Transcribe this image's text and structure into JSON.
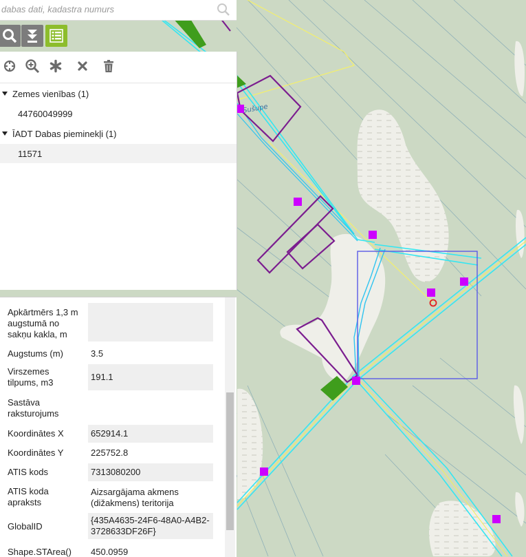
{
  "search": {
    "placeholder": "dabas dati, kadastra numurs"
  },
  "toolbar": {
    "search_icon": "search-icon",
    "download_icon": "download-icon",
    "list_icon": "list-icon"
  },
  "actions": [
    "crosshair-icon",
    "zoom-in-icon",
    "asterisk-icon",
    "close-icon",
    "trash-icon"
  ],
  "results": {
    "groups": [
      {
        "label": "Zemes vienības (1)",
        "items": [
          "44760049999"
        ]
      },
      {
        "label": "ĪADT Dabas pieminekļi (1)",
        "items": [
          "11571"
        ]
      }
    ]
  },
  "details": [
    {
      "key": "Apkārtmērs 1,3 m augstumā no sakņu kakla, m",
      "value": ""
    },
    {
      "key": "Augstums (m)",
      "value": "3.5"
    },
    {
      "key": "Virszemes tilpums, m3",
      "value": "191.1"
    },
    {
      "key": "Sastāva raksturojums",
      "value": ""
    },
    {
      "key": "Koordinātes X",
      "value": "652914.1"
    },
    {
      "key": "Koordinātes Y",
      "value": "225752.8"
    },
    {
      "key": "ATIS kods",
      "value": "7313080200"
    },
    {
      "key": "ATIS koda apraksts",
      "value": "Aizsargājama akmens (dižakmens) teritorija"
    },
    {
      "key": "GlobalID",
      "value": "{435A4635-24F6-48A0-A4B2-3728633DF26F}"
    },
    {
      "key": "Shape.STArea()",
      "value": "450.0959"
    }
  ],
  "map": {
    "river_label": "Sušupe",
    "colors": {
      "forest": "#ccd9c4",
      "clearing": "#efefe9",
      "parcel_outline": "#7b1d8f",
      "marker": "#cc00ff",
      "road_cyan": "#33e6f2",
      "road_yellow": "#f2f25a",
      "boundary_yellow": "#f5f06a",
      "selection": "#5a5ae6",
      "green_fill": "#3f9d1c"
    }
  }
}
